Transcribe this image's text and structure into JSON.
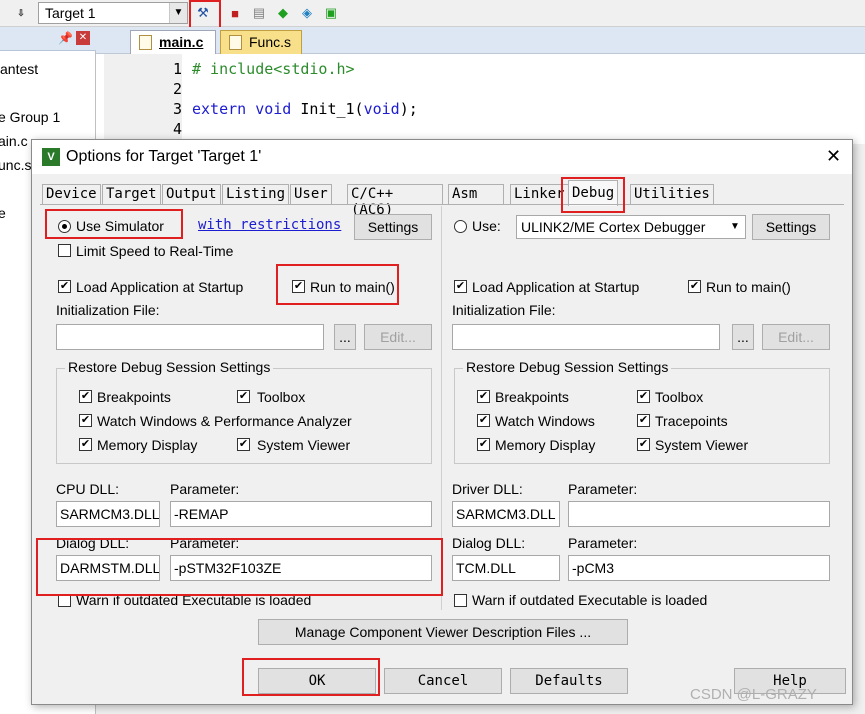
{
  "toolbar": {
    "target": "Target 1"
  },
  "project_panel": {
    "items": [
      "antest",
      "e Group 1",
      "ain.c",
      "unc.s",
      "e"
    ]
  },
  "editor": {
    "tabs": [
      "main.c",
      "Func.s"
    ],
    "lines": [
      {
        "n": "1",
        "text": "# include<stdio.h>"
      },
      {
        "n": "2",
        "text": ""
      },
      {
        "n": "3",
        "kw1": "extern",
        "kw2": "void",
        "mid": " Init_1(",
        "kw3": "void",
        "end": ");"
      },
      {
        "n": "4",
        "text": ""
      }
    ]
  },
  "dialog": {
    "title": "Options for Target 'Target 1'",
    "close": "✕",
    "tabs": [
      "Device",
      "Target",
      "Output",
      "Listing",
      "User",
      "C/C++ (AC6)",
      "Asm",
      "Linker",
      "Debug",
      "Utilities"
    ],
    "active_tab": "Debug",
    "left": {
      "use_simulator": "Use Simulator",
      "restrictions": "with restrictions",
      "settings": "Settings",
      "limit_speed": "Limit Speed to Real-Time",
      "load_app": "Load Application at Startup",
      "run_main": "Run to main()",
      "init_file": "Initialization File:",
      "browse": "...",
      "edit": "Edit...",
      "restore_group": "Restore Debug Session Settings",
      "breakpoints": "Breakpoints",
      "toolbox": "Toolbox",
      "watch": "Watch Windows & Performance Analyzer",
      "memory": "Memory Display",
      "sysviewer": "System Viewer",
      "cpu_dll_label": "CPU DLL:",
      "param_label": "Parameter:",
      "cpu_dll": "SARMCM3.DLL",
      "cpu_param": "-REMAP",
      "dialog_dll_label": "Dialog DLL:",
      "dialog_dll": "DARMSTM.DLL",
      "dialog_param": "-pSTM32F103ZE",
      "warn": "Warn if outdated Executable is loaded"
    },
    "right": {
      "use": "Use:",
      "debugger": "ULINK2/ME Cortex Debugger",
      "settings": "Settings",
      "load_app": "Load Application at Startup",
      "run_main": "Run to main()",
      "init_file": "Initialization File:",
      "browse": "...",
      "edit": "Edit...",
      "restore_group": "Restore Debug Session Settings",
      "breakpoints": "Breakpoints",
      "toolbox": "Toolbox",
      "watch": "Watch Windows",
      "tracepoints": "Tracepoints",
      "memory": "Memory Display",
      "sysviewer": "System Viewer",
      "driver_dll_label": "Driver DLL:",
      "param_label": "Parameter:",
      "driver_dll": "SARMCM3.DLL",
      "driver_param": "",
      "dialog_dll_label": "Dialog DLL:",
      "dialog_dll": "TCM.DLL",
      "dialog_param": "-pCM3",
      "warn": "Warn if outdated Executable is loaded"
    },
    "manage": "Manage Component Viewer Description Files ...",
    "ok": "OK",
    "cancel": "Cancel",
    "defaults": "Defaults",
    "help": "Help"
  },
  "watermark": "CSDN @L-GRAZY",
  "colors": {
    "highlight": "#e02020",
    "keyword": "#1c1cd0",
    "comment": "#2c8c2c"
  }
}
